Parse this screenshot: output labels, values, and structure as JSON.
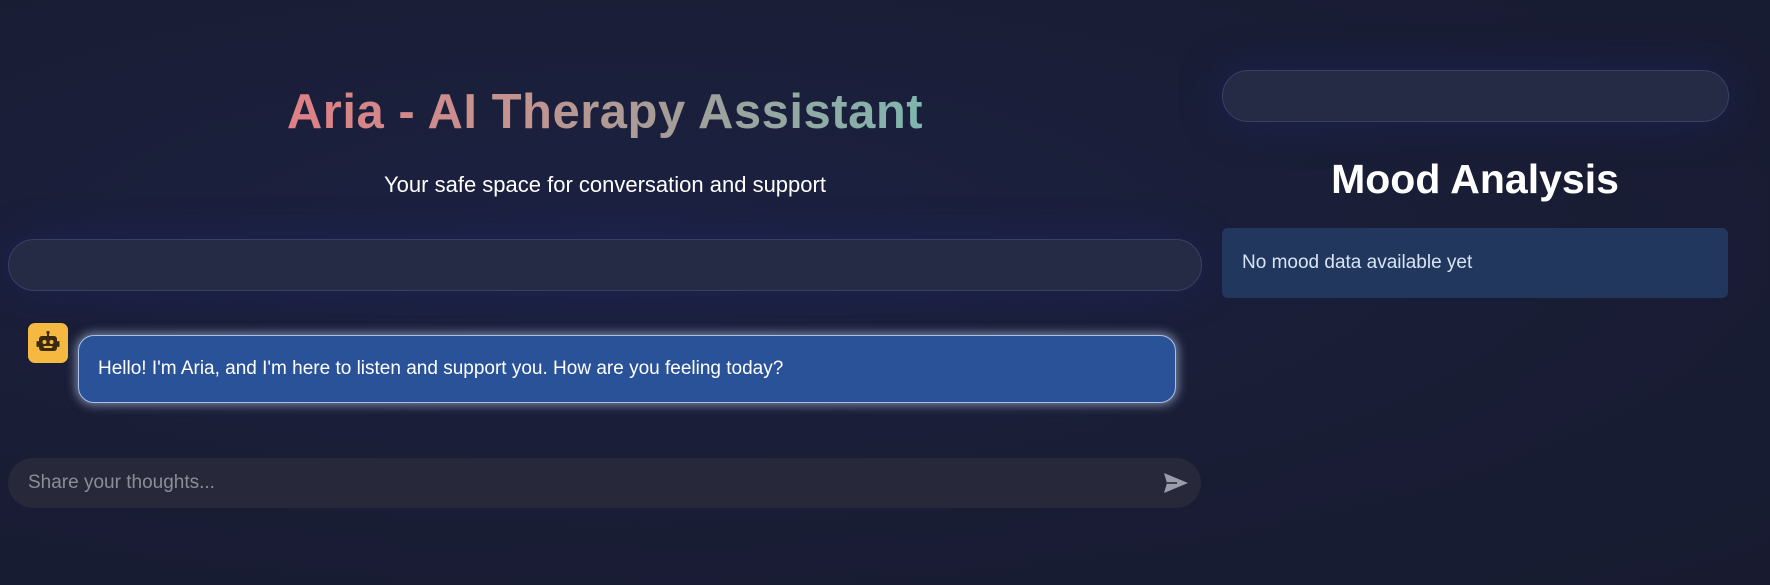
{
  "header": {
    "title": "Aria - AI Therapy Assistant",
    "subtitle": "Your safe space for conversation and support"
  },
  "chat": {
    "messages": [
      {
        "sender": "assistant",
        "avatar_icon": "robot-icon",
        "text": "Hello! I'm Aria, and I'm here to listen and support you. How are you feeling today?"
      }
    ],
    "input": {
      "value": "",
      "placeholder": "Share your thoughts...",
      "send_icon": "send-icon"
    }
  },
  "sidebar": {
    "title": "Mood Analysis",
    "mood_status": "No mood data available yet"
  },
  "colors": {
    "background": "#191d35",
    "assistant_bubble": "#2a5298",
    "avatar": "#f5b942",
    "mood_box": "#22375e",
    "input_background": "#27283a",
    "title_gradient_start": "#e07f85",
    "title_gradient_end": "#7fb6ae"
  }
}
